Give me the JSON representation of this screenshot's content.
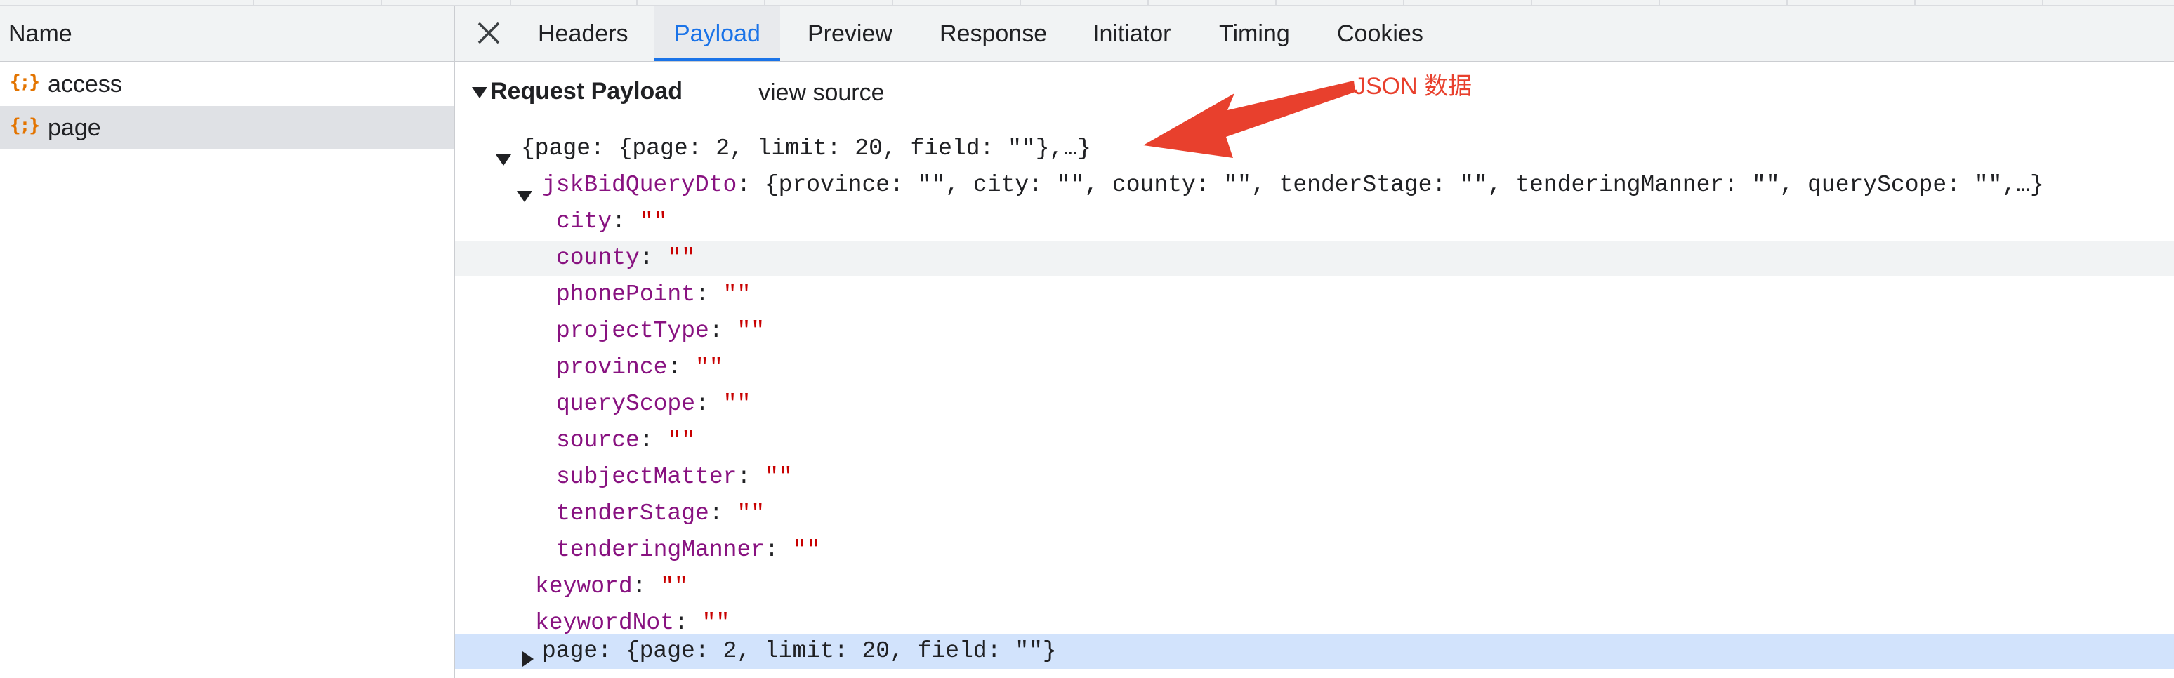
{
  "left_panel": {
    "header_label": "Name",
    "requests": [
      {
        "icon": "{;}",
        "name": "access",
        "selected": false
      },
      {
        "icon": "{;}",
        "name": "page",
        "selected": true
      }
    ]
  },
  "tabs": [
    "Headers",
    "Payload",
    "Preview",
    "Response",
    "Initiator",
    "Timing",
    "Cookies"
  ],
  "active_tab": "Payload",
  "payload": {
    "section_title": "Request Payload",
    "view_source_label": "view source",
    "annotation_text": "JSON 数据",
    "annotation_color": "#e8402d",
    "root_summary": "{page: {page: 2, limit: 20, field: \"\"},…}",
    "dto_key": "jskBidQueryDto",
    "dto_summary": ": {province: \"\", city: \"\", county: \"\", tenderStage: \"\", tenderingManner: \"\", queryScope: \"\",…}",
    "dto_fields": [
      {
        "key": "city",
        "value": "\"\""
      },
      {
        "key": "county",
        "value": "\"\""
      },
      {
        "key": "phonePoint",
        "value": "\"\""
      },
      {
        "key": "projectType",
        "value": "\"\""
      },
      {
        "key": "province",
        "value": "\"\""
      },
      {
        "key": "queryScope",
        "value": "\"\""
      },
      {
        "key": "source",
        "value": "\"\""
      },
      {
        "key": "subjectMatter",
        "value": "\"\""
      },
      {
        "key": "tenderStage",
        "value": "\"\""
      },
      {
        "key": "tenderingManner",
        "value": "\"\""
      }
    ],
    "keyword": {
      "key": "keyword",
      "value": "\"\""
    },
    "keywordNot": {
      "key": "keywordNot",
      "value": "\"\""
    },
    "page_key": "page",
    "page_summary": ": {page: 2, limit: 20, field: \"\"}"
  },
  "colors": {
    "accent": "#1a73e8",
    "key": "#881280",
    "string": "#c80000",
    "icon": "#e37400",
    "selected_row": "#d2e3fc"
  }
}
